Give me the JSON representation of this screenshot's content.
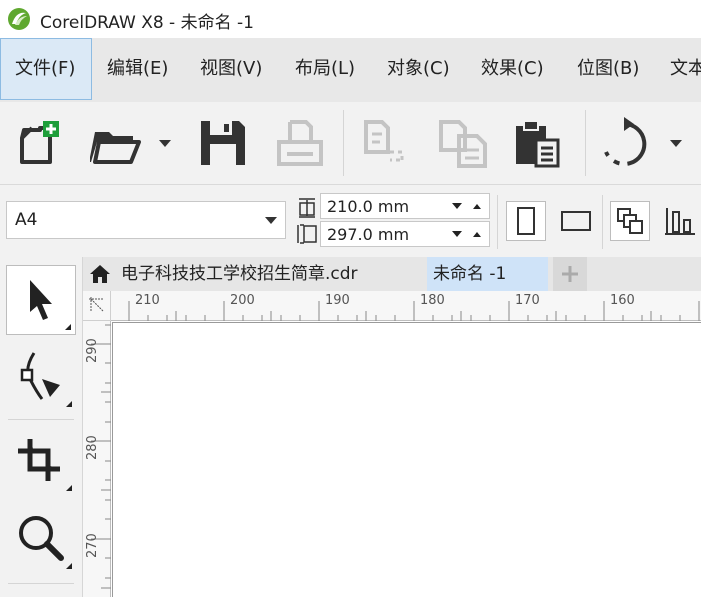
{
  "title_bar": {
    "title": "CorelDRAW X8 - 未命名 -1"
  },
  "menu": {
    "items": [
      {
        "label": "文件(F)",
        "active": true
      },
      {
        "label": "编辑(E)"
      },
      {
        "label": "视图(V)"
      },
      {
        "label": "布局(L)"
      },
      {
        "label": "对象(C)"
      },
      {
        "label": "效果(C)"
      },
      {
        "label": "位图(B)"
      },
      {
        "label": "文本"
      }
    ]
  },
  "toolbar": {
    "icons": [
      "new-document-icon",
      "open-folder-icon",
      "save-icon",
      "print-icon",
      "cut-icon",
      "copy-icon",
      "paste-icon",
      "undo-icon"
    ]
  },
  "property_bar": {
    "page_size": "A4",
    "width": "210.0 mm",
    "height": "297.0 mm"
  },
  "document_tabs": [
    {
      "label": "电子科技技工学校招生简章.cdr",
      "active": false
    },
    {
      "label": "未命名 -1",
      "active": true
    }
  ],
  "rulers": {
    "horizontal": [
      "210",
      "200",
      "190",
      "180",
      "170",
      "160"
    ],
    "vertical": [
      "290",
      "280",
      "270"
    ]
  },
  "colors": {
    "menu_active_bg": "#dbe9f6",
    "tab_active_bg": "#cfe3f8",
    "logo_green": "#5fa82f"
  }
}
